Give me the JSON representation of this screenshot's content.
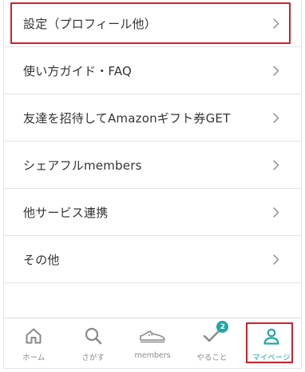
{
  "menu": {
    "items": [
      {
        "label": "設定（プロフィール他）"
      },
      {
        "label": "使い方ガイド・FAQ"
      },
      {
        "label": "友達を招待してAmazonギフト券GET"
      },
      {
        "label": "シェアフルmembers"
      },
      {
        "label": "他サービス連携"
      },
      {
        "label": "その他"
      }
    ]
  },
  "tabbar": {
    "tabs": [
      {
        "label": "ホーム",
        "icon": "home-icon"
      },
      {
        "label": "さがす",
        "icon": "search-icon"
      },
      {
        "label": "members",
        "icon": "shoe-icon"
      },
      {
        "label": "やること",
        "icon": "check-icon",
        "badge": "2"
      },
      {
        "label": "マイページ",
        "icon": "person-icon",
        "active": true
      }
    ]
  },
  "colors": {
    "accent": "#23a6a6",
    "highlight": "#d0202a",
    "text": "#333333",
    "inactive": "#8a8a8a"
  }
}
